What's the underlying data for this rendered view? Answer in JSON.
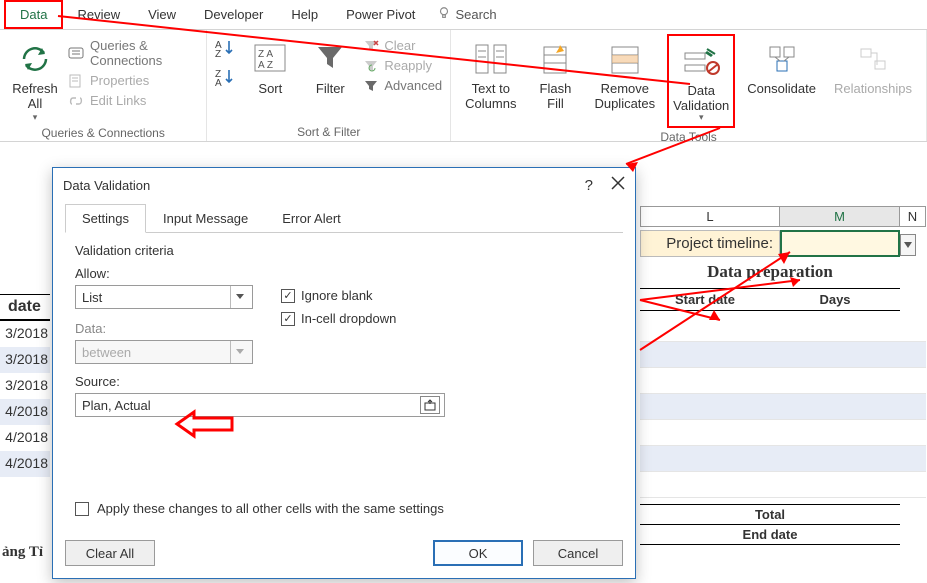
{
  "menu": {
    "data": "Data",
    "review": "Review",
    "view": "View",
    "developer": "Developer",
    "help": "Help",
    "powerpivot": "Power Pivot",
    "search": "Search"
  },
  "ribbon": {
    "queries_group": "Queries & Connections",
    "refresh": "Refresh All",
    "queries": "Queries & Connections",
    "properties": "Properties",
    "editlinks": "Edit Links",
    "sortfilter_group": "Sort & Filter",
    "sort": "Sort",
    "filter": "Filter",
    "clear": "Clear",
    "reapply": "Reapply",
    "advanced": "Advanced",
    "datatools_group": "Data Tools",
    "texttocolumns": "Text to Columns",
    "flashfill": "Flash Fill",
    "removeduplicates": "Remove Duplicates",
    "datavalidation": "Data Validation",
    "consolidate": "Consolidate",
    "relationships": "Relationships"
  },
  "sheet": {
    "colL": "L",
    "colM": "M",
    "colN": "N",
    "project_timeline": "Project timeline:",
    "data_prep": "Data preparation",
    "start_date": "Start date",
    "days": "Days",
    "total": "Total",
    "end_date": "End date",
    "left_header": "date",
    "d1": "3/2018",
    "d2": "3/2018",
    "d3": "3/2018",
    "d4": "4/2018",
    "d5": "4/2018",
    "d6": "4/2018",
    "footer": "ảng Tỉ"
  },
  "dialog": {
    "title": "Data Validation",
    "help": "?",
    "tab_settings": "Settings",
    "tab_input": "Input Message",
    "tab_error": "Error Alert",
    "criteria": "Validation criteria",
    "allow": "Allow:",
    "allow_val": "List",
    "ignore_blank": "Ignore blank",
    "incell": "In-cell dropdown",
    "data": "Data:",
    "data_val": "between",
    "source": "Source:",
    "source_val": "Plan, Actual",
    "apply_all": "Apply these changes to all other cells with the same settings",
    "clear_all": "Clear All",
    "ok": "OK",
    "cancel": "Cancel"
  }
}
